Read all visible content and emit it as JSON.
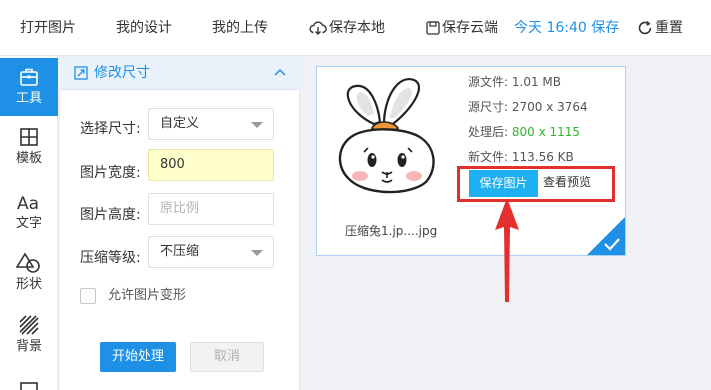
{
  "topbar": {
    "open_image": "打开图片",
    "my_design": "我的设计",
    "my_upload": "我的上传",
    "save_local": "保存本地",
    "save_cloud": "保存云端",
    "saved_status": "今天 16:40 保存",
    "reset": "重置"
  },
  "sidebar": {
    "items": [
      {
        "label": "工具",
        "icon": "toolbox-icon",
        "active": true
      },
      {
        "label": "模板",
        "icon": "template-grid-icon"
      },
      {
        "label": "文字",
        "icon": "text-aa-icon"
      },
      {
        "label": "形状",
        "icon": "shapes-icon"
      },
      {
        "label": "背景",
        "icon": "background-stripes-icon"
      }
    ]
  },
  "panel": {
    "title": "修改尺寸",
    "size_label": "选择尺寸:",
    "size_value": "自定义",
    "width_label": "图片宽度:",
    "width_value": "800",
    "height_label": "图片高度:",
    "height_placeholder": "原比例",
    "compress_label": "压缩等级:",
    "compress_value": "不压缩",
    "allow_deform": "允许图片变形",
    "start_button": "开始处理",
    "cancel_button": "取消"
  },
  "card": {
    "source_file_label": "源文件:",
    "source_file_value": "1.01 MB",
    "source_size_label": "源尺寸:",
    "source_size_value": "2700 x 3764",
    "processed_label": "处理后:",
    "processed_value": "800 x 1115",
    "new_file_label": "新文件:",
    "new_file_value": "113.56 KB",
    "save_image": "保存图片",
    "view_preview": "查看预览",
    "filename": "压缩兔1.jp....jpg"
  },
  "colors": {
    "accent": "#1e90e6",
    "save_button": "#1eb0f0",
    "highlight": "#e3302f",
    "processed": "#2fb52f"
  }
}
